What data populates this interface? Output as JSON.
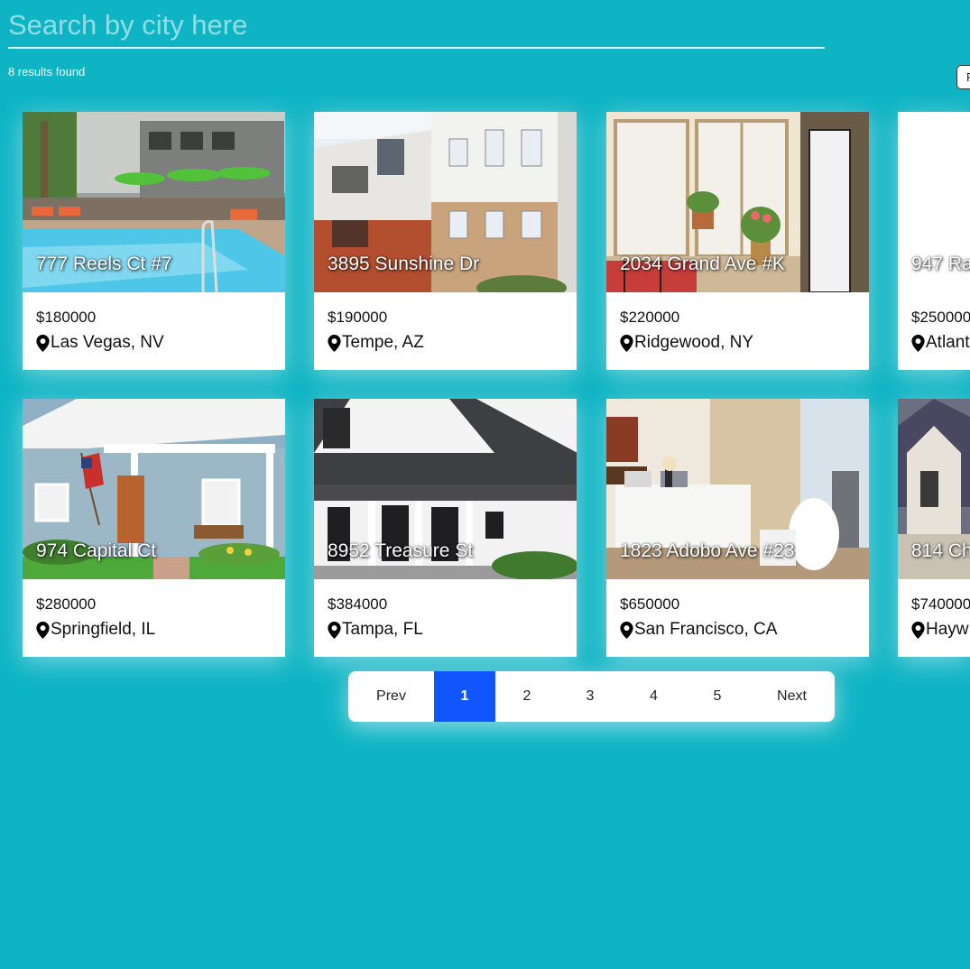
{
  "search": {
    "placeholder": "Search by city here",
    "value": ""
  },
  "results": {
    "count_text": "8 results found"
  },
  "filter_button": {
    "label": "F"
  },
  "listings": [
    {
      "address": "777 Reels Ct #7",
      "price": "$180000",
      "location": "Las Vegas, NV",
      "photo": "pool"
    },
    {
      "address": "3895 Sunshine Dr",
      "price": "$190000",
      "location": "Tempe, AZ",
      "photo": "apartment"
    },
    {
      "address": "2034 Grand Ave #K",
      "price": "$220000",
      "location": "Ridgewood, NY",
      "photo": "interior-window"
    },
    {
      "address": "947 Ra",
      "price": "$250000",
      "location": "Atlant",
      "photo": "blank"
    },
    {
      "address": "974 Capital Ct",
      "price": "$280000",
      "location": "Springfield, IL",
      "photo": "blue-house"
    },
    {
      "address": "8952 Treasure St",
      "price": "$384000",
      "location": "Tampa, FL",
      "photo": "farmhouse"
    },
    {
      "address": "1823 Adobo Ave #23",
      "price": "$650000",
      "location": "San Francisco, CA",
      "photo": "bedroom"
    },
    {
      "address": "814 Ch",
      "price": "$740000",
      "location": "Hayw",
      "photo": "victorian"
    }
  ],
  "pagination": {
    "prev_label": "Prev",
    "pages": [
      "1",
      "2",
      "3",
      "4",
      "5"
    ],
    "current_page": "1",
    "next_label": "Next",
    "active_color": "#1155ff"
  },
  "colors": {
    "background": "#0eb4c4",
    "card": "#ffffff",
    "text": "#111111"
  },
  "icons": {
    "location": "map-pin-icon"
  }
}
